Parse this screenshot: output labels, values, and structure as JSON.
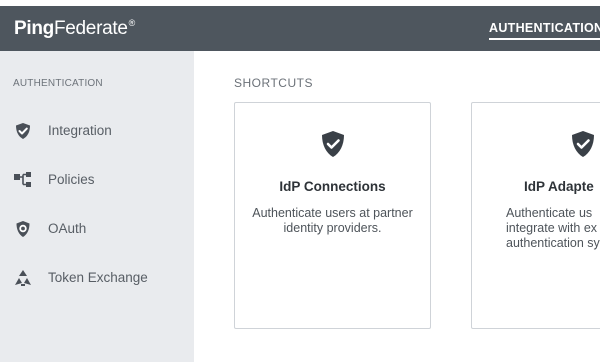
{
  "header": {
    "logo_bold": "Ping",
    "logo_light": "Federate",
    "logo_mark": "®",
    "nav_active": "AUTHENTICATION"
  },
  "sidebar": {
    "heading": "AUTHENTICATION",
    "items": [
      {
        "label": "Integration",
        "icon": "shield-check-icon"
      },
      {
        "label": "Policies",
        "icon": "policy-tree-icon"
      },
      {
        "label": "OAuth",
        "icon": "oauth-shield-icon"
      },
      {
        "label": "Token Exchange",
        "icon": "token-exchange-icon"
      }
    ]
  },
  "main": {
    "heading": "SHORTCUTS",
    "cards": [
      {
        "title": "IdP Connections",
        "description": "Authenticate users at partner identity providers.",
        "icon": "shield-check-icon"
      },
      {
        "title": "IdP Adapte",
        "description": "Authenticate us integrate with ex authentication sy",
        "icon": "shield-check-icon"
      }
    ]
  },
  "colors": {
    "header_bg": "#4e565e",
    "sidebar_bg": "#e9ebee",
    "icon_dark": "#3a4047"
  }
}
